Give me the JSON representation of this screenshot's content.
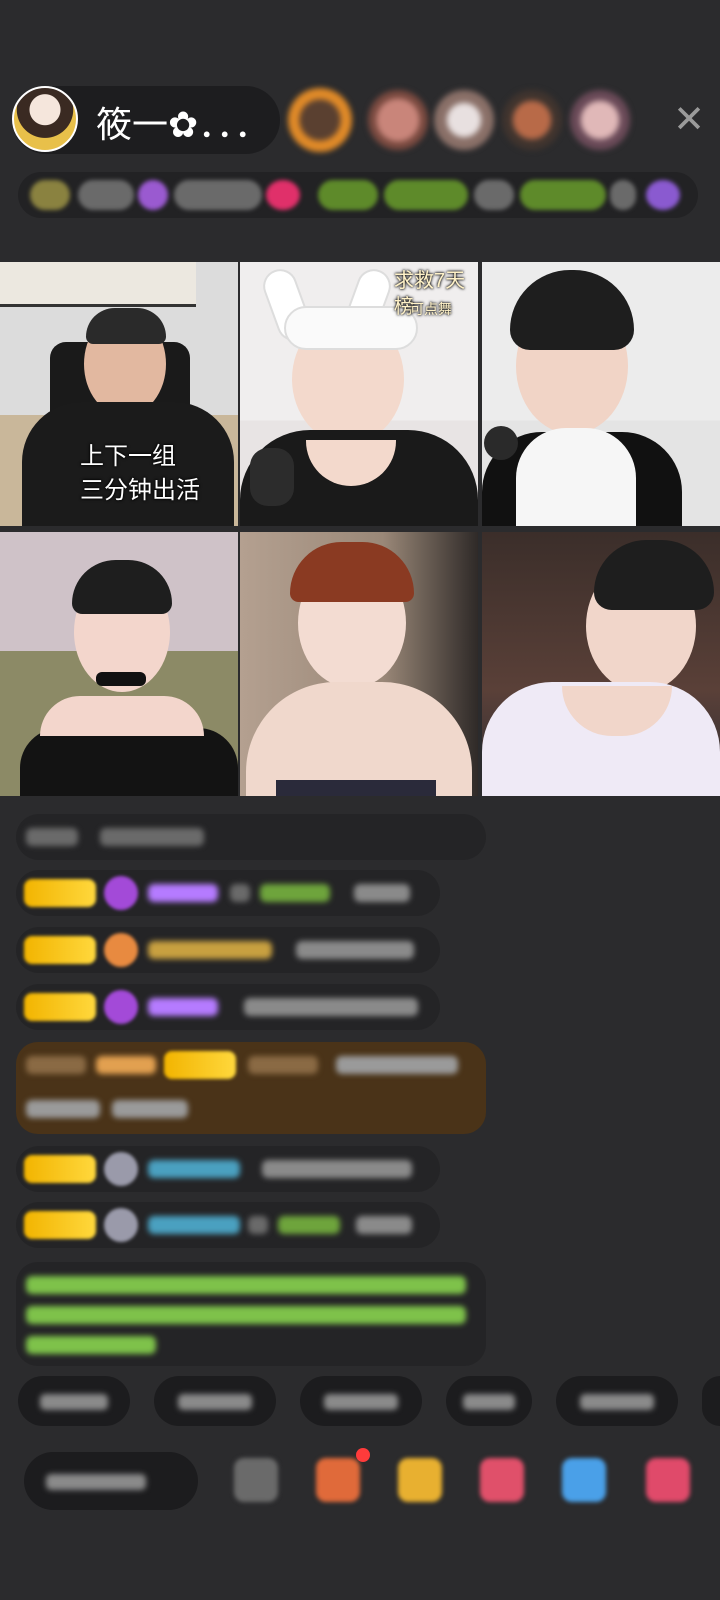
{
  "host": {
    "name": "筱一✿．．．"
  },
  "header": {
    "close_icon": "close-icon"
  },
  "grid": {
    "tiles": [
      {
        "id": "tile-1",
        "overlay_lines": [
          "上下一组",
          "三分钟出活"
        ]
      },
      {
        "id": "tile-2",
        "overlay_title": "求救7天榜",
        "overlay_sub": "可点舞"
      },
      {
        "id": "tile-3"
      },
      {
        "id": "tile-4"
      },
      {
        "id": "tile-5"
      },
      {
        "id": "tile-6"
      }
    ]
  },
  "colors": {
    "background": "#2b2b2d",
    "badge_gold": "#f2b400",
    "chat_green": "#7ec24a",
    "chat_purple": "#b57bff",
    "highlight_row": "#4a3318"
  },
  "icons": [
    "close-icon",
    "gift-icon",
    "red-packet-icon",
    "chat-icon"
  ]
}
